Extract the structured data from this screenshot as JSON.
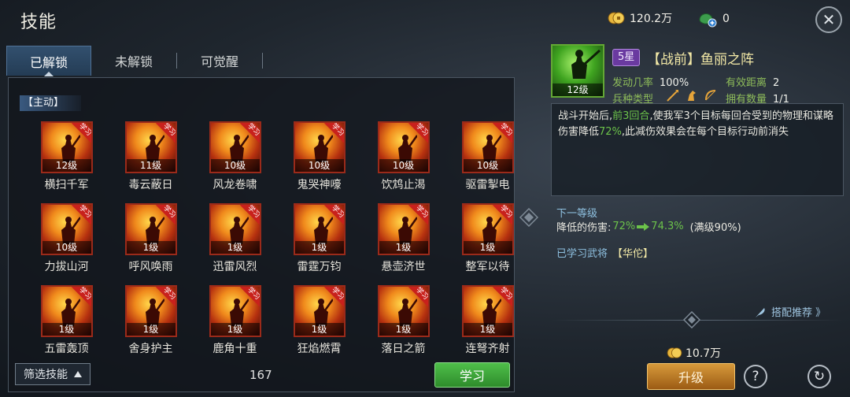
{
  "header": {
    "title": "技能",
    "gold": "120.2万",
    "jade": "0",
    "close_glyph": "✕"
  },
  "tabs": [
    {
      "label": "已解锁",
      "active": true
    },
    {
      "label": "未解锁",
      "active": false
    },
    {
      "label": "可觉醒",
      "active": false
    }
  ],
  "left": {
    "section_label": "【主动】",
    "skills": [
      {
        "name": "横扫千军",
        "level": "12级",
        "badge": "学习"
      },
      {
        "name": "毒云蔽日",
        "level": "11级",
        "badge": "学习"
      },
      {
        "name": "风龙卷啸",
        "level": "10级",
        "badge": "学习"
      },
      {
        "name": "鬼哭神嚎",
        "level": "10级",
        "badge": "学习"
      },
      {
        "name": "饮鸩止渴",
        "level": "10级",
        "badge": "学习"
      },
      {
        "name": "驱雷掣电",
        "level": "10级",
        "badge": "学习"
      },
      {
        "name": "力拔山河",
        "level": "10级",
        "badge": "学习"
      },
      {
        "name": "呼风唤雨",
        "level": "1级",
        "badge": "学习"
      },
      {
        "name": "迅雷风烈",
        "level": "1级",
        "badge": "学习"
      },
      {
        "name": "雷霆万钧",
        "level": "1级",
        "badge": "学习"
      },
      {
        "name": "悬壶济世",
        "level": "1级",
        "badge": "学习"
      },
      {
        "name": "整军以待",
        "level": "1级",
        "badge": "学习"
      },
      {
        "name": "五雷轰顶",
        "level": "1级",
        "badge": "学习"
      },
      {
        "name": "舍身护主",
        "level": "1级",
        "badge": "学习"
      },
      {
        "name": "鹿角十重",
        "level": "1级",
        "badge": "学习"
      },
      {
        "name": "狂焰燃霄",
        "level": "1级",
        "badge": "学习"
      },
      {
        "name": "落日之箭",
        "level": "1级",
        "badge": "学习"
      },
      {
        "name": "连弩齐射",
        "level": "1级",
        "badge": "学习"
      }
    ],
    "filter_label": "筛选技能",
    "count": "167",
    "learn_label": "学习"
  },
  "detail": {
    "icon_level": "12级",
    "star": "5星",
    "title": "【战前】鱼丽之阵",
    "trigger_label": "发动几率",
    "trigger_value": "100%",
    "range_label": "有效距离",
    "range_value": "2",
    "troop_label": "兵种类型",
    "own_label": "拥有数量",
    "own_value": "1/1",
    "desc_1": "战斗开始后,",
    "desc_hl1": "前3回合",
    "desc_2": ",使我军3个目标每回合受到的物理和谋略伤害降低",
    "desc_hl2": "72%",
    "desc_3": ",此减伤效果会在每个目标行动前消失",
    "next_label": "下一等级",
    "dmg_label": "降低的伤害:",
    "dmg_from": "72%",
    "dmg_to": "74.3%",
    "dmg_max": "(满级90%)",
    "learned_label": "已学习武将",
    "learned_name": "【华佗】",
    "recommend_label": "搭配推荐 》",
    "cost": "10.7万",
    "upgrade_label": "升级",
    "help_glyph": "?",
    "refresh_glyph": "↻"
  },
  "colors": {
    "highlight_green": "#6cc34a",
    "title_gold": "#f2e8a6",
    "star_purple": "#6a3aa0"
  }
}
